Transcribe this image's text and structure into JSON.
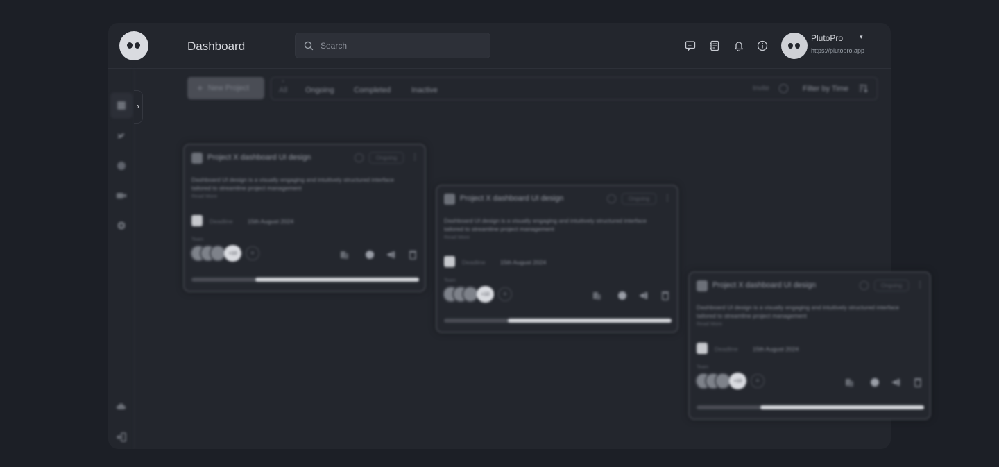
{
  "header": {
    "page_title": "Dashboard",
    "search_placeholder": "Search",
    "icons": [
      "message-icon",
      "notes-icon",
      "bell-icon",
      "info-icon"
    ]
  },
  "user": {
    "name": "PlutoPro",
    "url": "https://plutopro.app"
  },
  "sidebar": {
    "items": [
      "dashboard-icon",
      "twitter-icon",
      "globe-icon",
      "video-icon",
      "settings-icon"
    ],
    "bottom_items": [
      "cloud-icon",
      "logout-icon"
    ]
  },
  "toolbar": {
    "new_project_label": "New Project",
    "tabs": [
      {
        "label": "All",
        "active": true
      },
      {
        "label": "Ongoing",
        "active": false
      },
      {
        "label": "Completed",
        "active": false
      },
      {
        "label": "Inactive",
        "active": false
      }
    ],
    "invite_label": "Invite",
    "filter_label": "Filter by Time"
  },
  "cards": [
    {
      "title": "Project X dashboard UI design",
      "status": "Ongoing",
      "description": "Dashboard UI design is a visually engaging and intuitively structured interface tailored to streamline project management",
      "read_more": "Read More",
      "deadline_label": "Deadline",
      "deadline_date": "15th August 2024",
      "team_label": "Team",
      "team_more": "+10",
      "progress": 0.72
    },
    {
      "title": "Project X dashboard UI design",
      "status": "Ongoing",
      "description": "Dashboard UI design is a visually engaging and intuitively structured interface tailored to streamline project management",
      "read_more": "Read More",
      "deadline_label": "Deadline",
      "deadline_date": "15th August 2024",
      "team_label": "Team",
      "team_more": "+10",
      "progress": 0.72
    },
    {
      "title": "Project X dashboard UI design",
      "status": "Ongoing",
      "description": "Dashboard UI design is a visually engaging and intuitively structured interface tailored to streamline project management",
      "read_more": "Read More",
      "deadline_label": "Deadline",
      "deadline_date": "15th August 2024",
      "team_label": "Team",
      "team_more": "+10",
      "progress": 0.72
    }
  ],
  "colors": {
    "background": "#1c1f26",
    "panel": "#23262d",
    "accent": "#d8dadf"
  }
}
